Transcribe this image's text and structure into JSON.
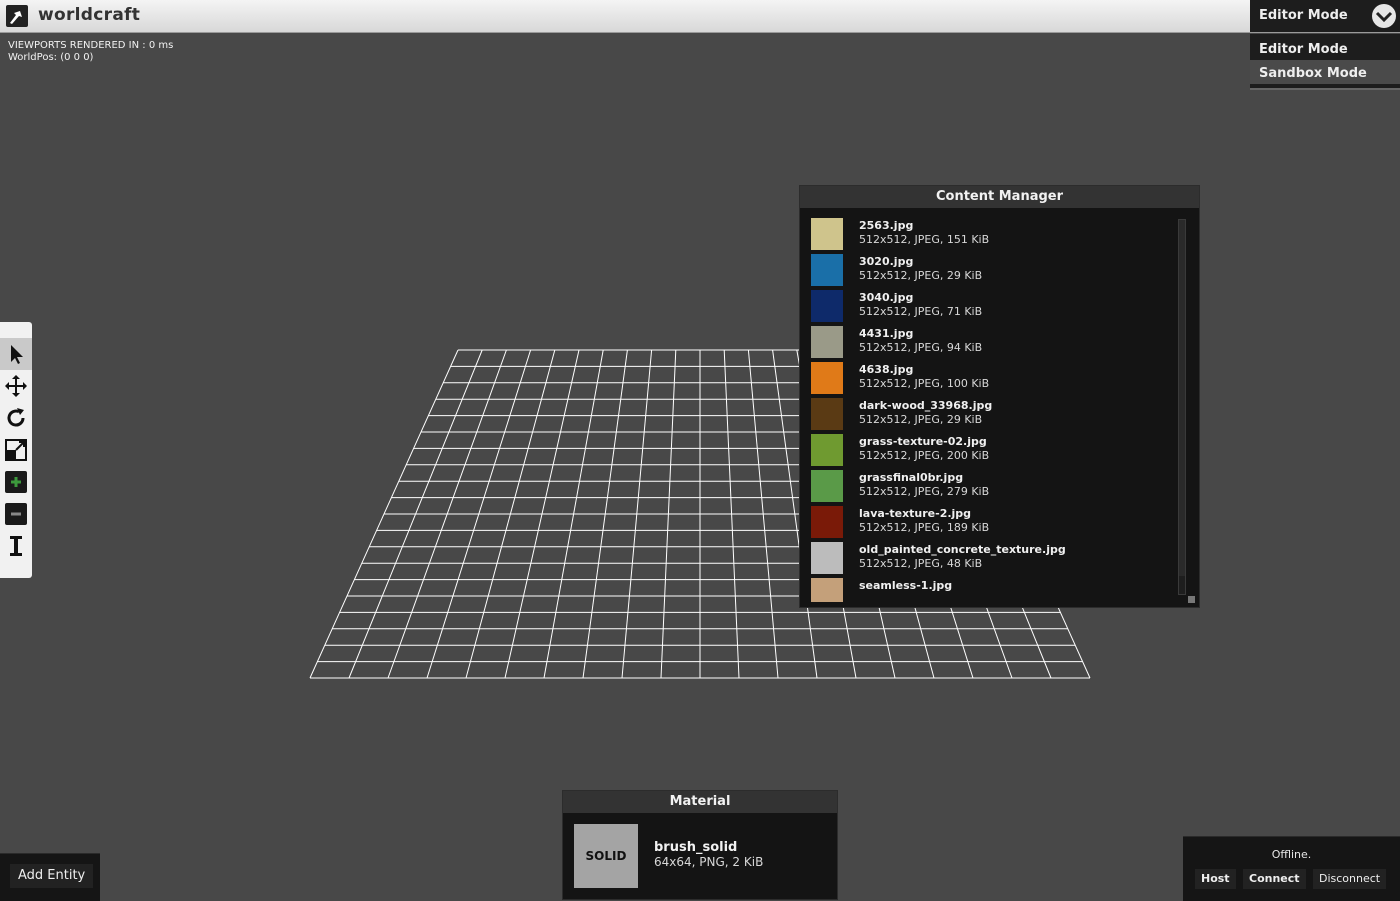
{
  "app": {
    "title": "worldcraft"
  },
  "mode": {
    "selected": "Editor Mode",
    "options": [
      "Editor Mode",
      "Sandbox Mode"
    ]
  },
  "debug": {
    "viewports": "VIEWPORTS RENDERED IN : 0 ms",
    "worldpos": "WorldPos: (0 0 0)"
  },
  "toolbar": {
    "tools": [
      {
        "icon": "select-arrow-icon",
        "active": true
      },
      {
        "icon": "move-arrows-icon",
        "active": false
      },
      {
        "icon": "rotate-icon",
        "active": false
      },
      {
        "icon": "scale-icon",
        "active": false
      },
      {
        "icon": "add-brush-icon",
        "active": false
      },
      {
        "icon": "subtract-brush-icon",
        "active": false
      },
      {
        "icon": "text-cursor-icon",
        "active": false
      }
    ]
  },
  "content_manager": {
    "title": "Content Manager",
    "items": [
      {
        "name": "2563.jpg",
        "meta": "512x512, JPEG, 151 KiB",
        "color": "#cfc48c"
      },
      {
        "name": "3020.jpg",
        "meta": "512x512, JPEG, 29 KiB",
        "color": "#1a6fa8"
      },
      {
        "name": "3040.jpg",
        "meta": "512x512, JPEG, 71 KiB",
        "color": "#0e2a6a"
      },
      {
        "name": "4431.jpg",
        "meta": "512x512, JPEG, 94 KiB",
        "color": "#9a9a88"
      },
      {
        "name": "4638.jpg",
        "meta": "512x512, JPEG, 100 KiB",
        "color": "#e07a18"
      },
      {
        "name": "dark-wood_33968.jpg",
        "meta": "512x512, JPEG, 29 KiB",
        "color": "#5a3a14"
      },
      {
        "name": "grass-texture-02.jpg",
        "meta": "512x512, JPEG, 200 KiB",
        "color": "#6f9a30"
      },
      {
        "name": "grassfinal0br.jpg",
        "meta": "512x512, JPEG, 279 KiB",
        "color": "#5a9a48"
      },
      {
        "name": "lava-texture-2.jpg",
        "meta": "512x512, JPEG, 189 KiB",
        "color": "#7a1a08"
      },
      {
        "name": "old_painted_concrete_texture.jpg",
        "meta": "512x512, JPEG, 48 KiB",
        "color": "#bcbcbc"
      },
      {
        "name": "seamless-1.jpg",
        "meta": "",
        "color": "#c4a07a"
      }
    ]
  },
  "material": {
    "title": "Material",
    "swatch_label": "SOLID",
    "name": "brush_solid",
    "meta": "64x64, PNG, 2 KiB"
  },
  "entity": {
    "add_label": "Add Entity"
  },
  "network": {
    "status": "Offline.",
    "host": "Host",
    "connect": "Connect",
    "disconnect": "Disconnect"
  }
}
